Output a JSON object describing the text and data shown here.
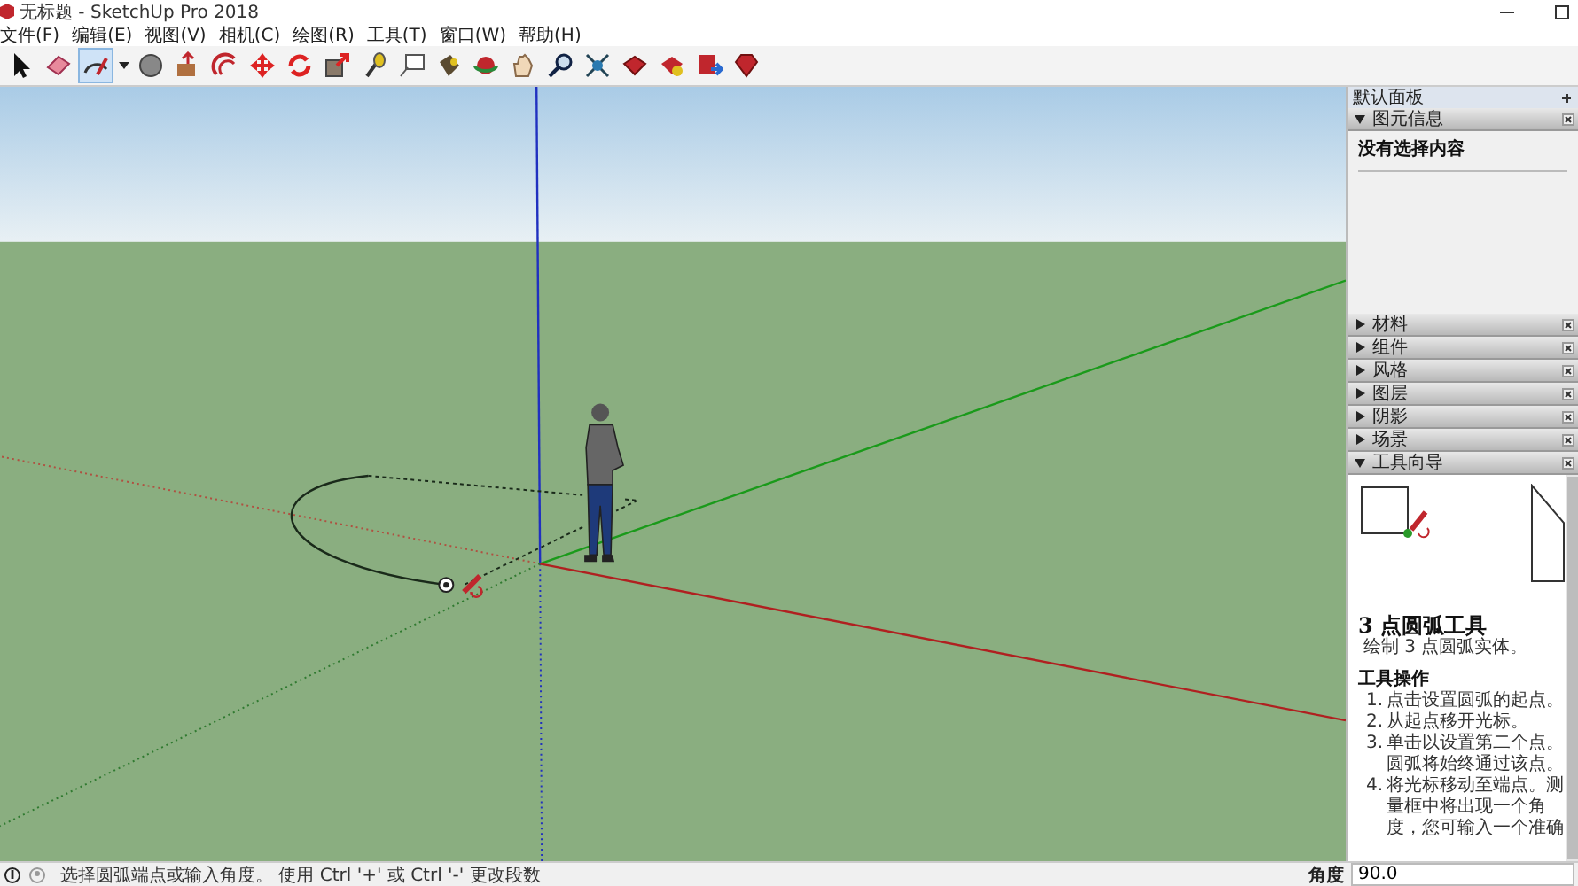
{
  "window": {
    "title": "无标题 - SketchUp Pro 2018"
  },
  "menu": [
    "文件(F)",
    "编辑(E)",
    "视图(V)",
    "相机(C)",
    "绘图(R)",
    "工具(T)",
    "窗口(W)",
    "帮助(H)"
  ],
  "toolbar": [
    {
      "kind": "select",
      "selected": false
    },
    {
      "kind": "eraser",
      "selected": false
    },
    {
      "kind": "arc",
      "selected": true
    },
    {
      "kind": "dropdown",
      "selected": false
    },
    {
      "kind": "shape",
      "selected": false
    },
    {
      "kind": "pushpull",
      "selected": false
    },
    {
      "kind": "offset",
      "selected": false
    },
    {
      "kind": "move",
      "selected": false
    },
    {
      "kind": "rotate",
      "selected": false
    },
    {
      "kind": "scale",
      "selected": false
    },
    {
      "kind": "tape",
      "selected": false
    },
    {
      "kind": "text",
      "selected": false
    },
    {
      "kind": "paint",
      "selected": false
    },
    {
      "kind": "orbit",
      "selected": false
    },
    {
      "kind": "pan",
      "selected": false
    },
    {
      "kind": "zoom",
      "selected": false
    },
    {
      "kind": "extents",
      "selected": false
    },
    {
      "kind": "warehouse",
      "selected": false
    },
    {
      "kind": "extension",
      "selected": false
    },
    {
      "kind": "share",
      "selected": false
    },
    {
      "kind": "ruby",
      "selected": false
    }
  ],
  "panel": {
    "title": "默认面板",
    "sections": [
      {
        "title": "图元信息",
        "expanded": true,
        "kind": "entity",
        "text": "没有选择内容"
      },
      {
        "title": "材料",
        "expanded": false
      },
      {
        "title": "组件",
        "expanded": false
      },
      {
        "title": "风格",
        "expanded": false
      },
      {
        "title": "图层",
        "expanded": false
      },
      {
        "title": "阴影",
        "expanded": false
      },
      {
        "title": "场景",
        "expanded": false
      },
      {
        "title": "工具向导",
        "expanded": true,
        "kind": "guide",
        "tool_name": "3 点圆弧工具",
        "description": "绘制 3 点圆弧实体。",
        "heading": "工具操作",
        "steps": [
          {
            "number": "1.",
            "text": "点击设置圆弧的起点。"
          },
          {
            "number": "2.",
            "text": "从起点移开光标。"
          },
          {
            "number": "3.",
            "text": "单击以设置第二个点。圆弧将始终通过该点。"
          },
          {
            "number": "4.",
            "text": "将光标移动至端点。测量框中将出现一个角度，您可输入一个准确"
          }
        ]
      }
    ]
  },
  "status_bar": {
    "message": "选择圆弧端点或输入角度。 使用 Ctrl '+' 或 Ctrl '-' 更改段数",
    "measure_label": "角度",
    "measure_value": "90.0"
  }
}
